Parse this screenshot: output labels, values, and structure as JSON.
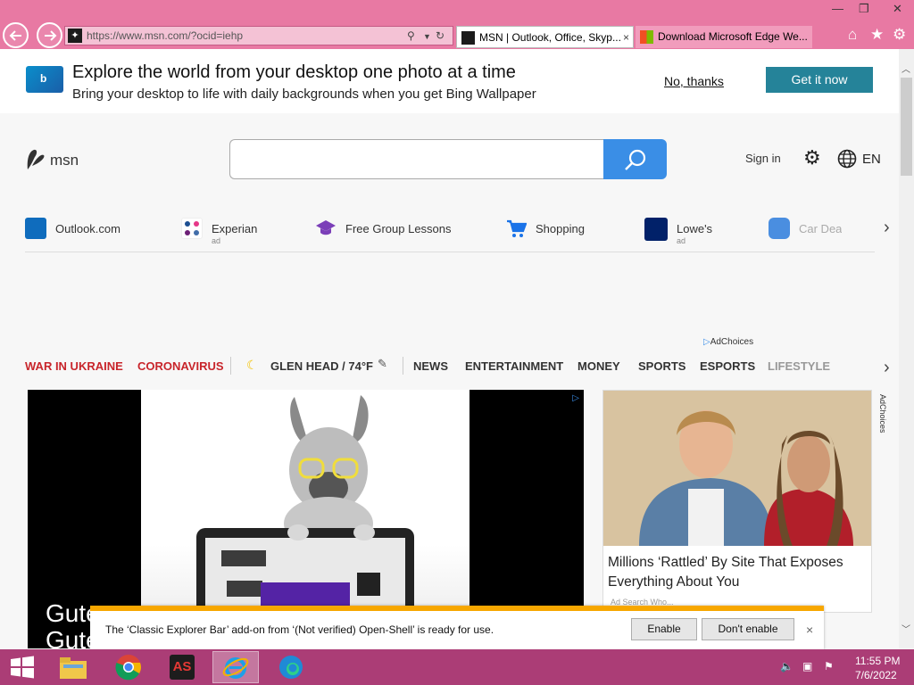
{
  "browser": {
    "address": "https://www.msn.com/?ocid=iehp",
    "tabs": [
      {
        "label": "MSN | Outlook, Office, Skyp...",
        "active": true
      },
      {
        "label": "Download Microsoft Edge We...",
        "active": false
      }
    ],
    "tab_close": "×",
    "accent_color": "#e879a3"
  },
  "banner": {
    "title": "Explore the world from your desktop one photo at a time",
    "subtitle": "Bring your desktop to life with daily backgrounds when you get Bing Wallpaper",
    "dismiss_label": "No, thanks",
    "cta_label": "Get it now",
    "cta_color": "#258399"
  },
  "header": {
    "logo_text": "msn",
    "search_placeholder": "",
    "sign_in": "Sign in",
    "language": "EN"
  },
  "quick_links": [
    {
      "label": "Outlook.com",
      "ad": "",
      "icon": "outlook-icon"
    },
    {
      "label": "Experian",
      "ad": "ad",
      "icon": "experian-icon"
    },
    {
      "label": "Free Group Lessons",
      "ad": "",
      "icon": "graduation-cap-icon"
    },
    {
      "label": "Shopping",
      "ad": "",
      "icon": "shopping-cart-icon"
    },
    {
      "label": "Lowe's",
      "ad": "ad",
      "icon": "lowes-icon"
    },
    {
      "label": "Car Deal",
      "ad": "",
      "icon": "car-icon"
    }
  ],
  "adchoices": "AdChoices",
  "categories": {
    "war": "WAR IN UKRAINE",
    "corona": "CORONAVIRUS",
    "weather": "GLEN HEAD / 74°F",
    "items": [
      "NEWS",
      "ENTERTAINMENT",
      "MONEY",
      "SPORTS",
      "ESPORTS",
      "LIFESTYLE"
    ]
  },
  "ad": {
    "headline": "Gute\nGute"
  },
  "article": {
    "title": "Millions ‘Rattled’ By Site That Exposes Everything About You",
    "source": "Ad  Search Who..."
  },
  "notification": {
    "text": "The ‘Classic Explorer Bar’ add-on from ‘(Not verified) Open-Shell’ is ready for use.",
    "enable": "Enable",
    "dont_enable": "Don't enable",
    "close": "×"
  },
  "taskbar": {
    "time": "11:55 PM",
    "date": "7/6/2022",
    "color": "#ab3d76"
  }
}
